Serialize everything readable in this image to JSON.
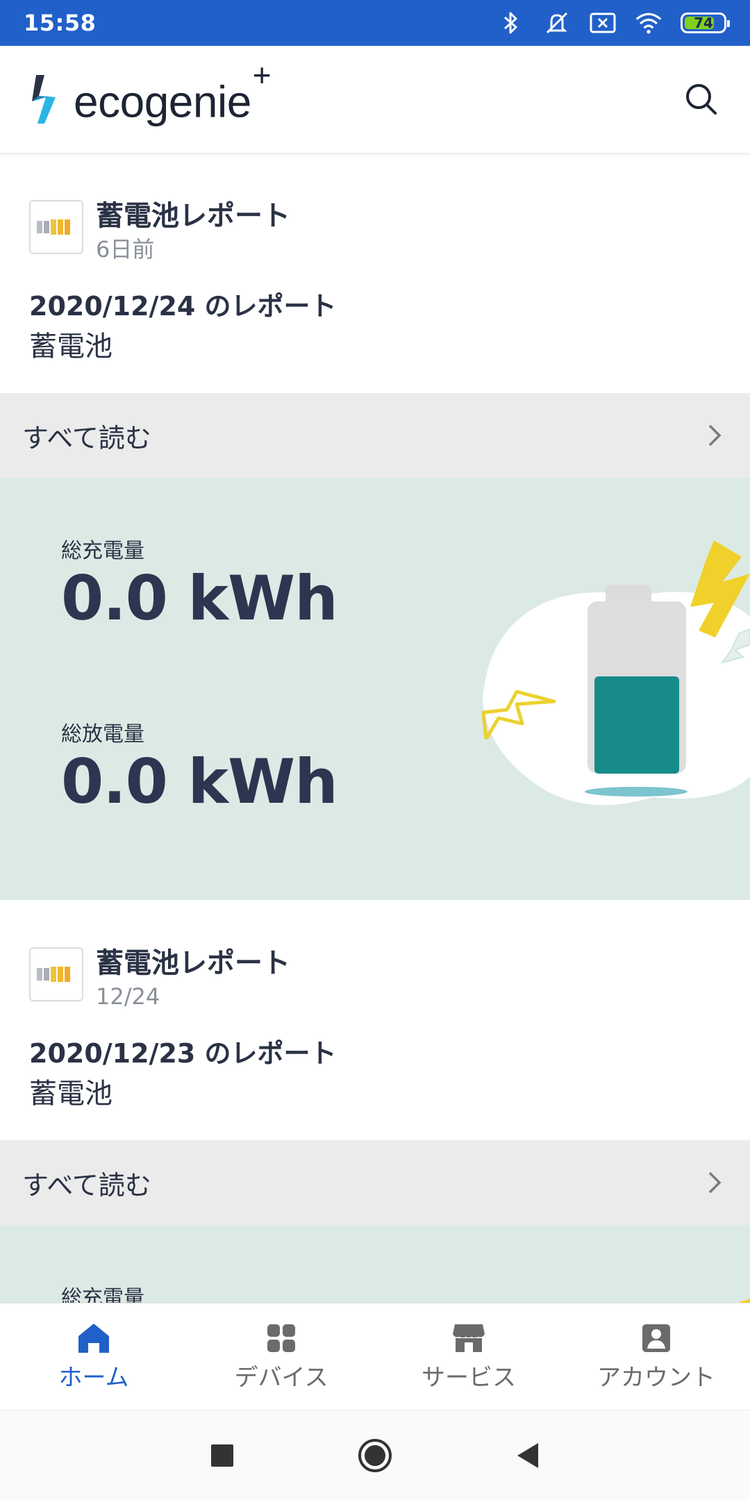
{
  "status_bar": {
    "time": "15:58",
    "battery_level": "74",
    "icons": [
      "bluetooth-icon",
      "mute-icon",
      "notification-x-icon",
      "wifi-icon",
      "battery-icon"
    ]
  },
  "app": {
    "logo_text": "ecogenie",
    "logo_sup": "+",
    "search_icon": "search-icon"
  },
  "feed": {
    "cards": [
      {
        "title": "蓄電池レポート",
        "time": "6日前",
        "report_date": "2020/12/24 のレポート",
        "device": "蓄電池",
        "read_all": "すべて読む",
        "charge_label": "総充電量",
        "charge_value": "0.0 kWh",
        "discharge_label": "総放電量",
        "discharge_value": "0.0 kWh"
      },
      {
        "title": "蓄電池レポート",
        "time": "12/24",
        "report_date": "2020/12/23 のレポート",
        "device": "蓄電池",
        "read_all": "すべて読む",
        "charge_label": "総充電量"
      }
    ]
  },
  "bottom_nav": {
    "items": [
      {
        "label": "ホーム",
        "icon": "home-icon",
        "active": true
      },
      {
        "label": "デバイス",
        "icon": "grid-icon",
        "active": false
      },
      {
        "label": "サービス",
        "icon": "store-icon",
        "active": false
      },
      {
        "label": "アカウント",
        "icon": "account-icon",
        "active": false
      }
    ]
  },
  "colors": {
    "status_bar": "#2260c9",
    "accent": "#2260c9",
    "stats_bg": "#dceae5",
    "battery_fill": "#168b89",
    "bolt_yellow": "#f0d02a"
  }
}
